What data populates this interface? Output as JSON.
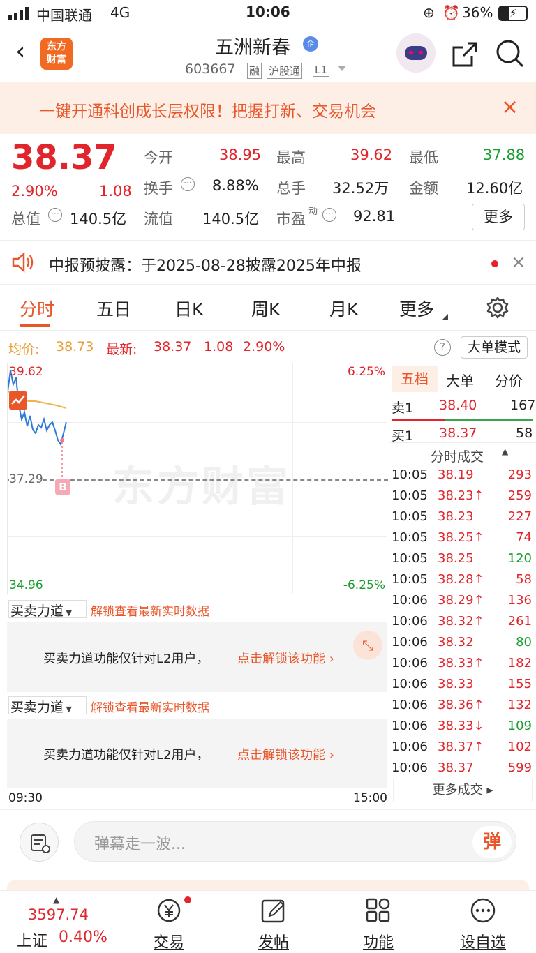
{
  "status": {
    "carrier": "中国联通",
    "network": "4G",
    "time": "10:06",
    "battery": "36%"
  },
  "nav": {
    "logo_line1": "东方",
    "logo_line2": "财富",
    "title": "五洲新春",
    "badge": "企",
    "code": "603667",
    "tag1": "融",
    "tag2": "沪股通",
    "tag3": "L1"
  },
  "banner": {
    "text": "一键开通科创成长层权限！把握打新、交易机会"
  },
  "quote": {
    "price": "38.37",
    "pct": "2.90%",
    "change": "1.08",
    "open_label": "今开",
    "open": "38.95",
    "high_label": "最高",
    "high": "39.62",
    "low_label": "最低",
    "low": "37.88",
    "turnover_label": "换手",
    "turnover": "8.88%",
    "volume_label": "总手",
    "volume": "32.52万",
    "amount_label": "金额",
    "amount": "12.60亿",
    "mcap_label": "总值",
    "mcap": "140.5亿",
    "float_label": "流值",
    "float": "140.5亿",
    "pe_label": "市盈",
    "pe_sup": "动",
    "pe": "92.81",
    "more": "更多"
  },
  "notice": {
    "text": "中报预披露：于2025-08-28披露2025年中报"
  },
  "tabs": [
    "分时",
    "五日",
    "日K",
    "周K",
    "月K",
    "更多"
  ],
  "legend": {
    "avg_label": "均价:",
    "avg": "38.73",
    "last_label": "最新:",
    "last": "38.37",
    "chg": "1.08",
    "pct": "2.90%",
    "mode": "大单模式"
  },
  "chart": {
    "top_left": "39.62",
    "top_right": "6.25%",
    "mid_left": "37.29",
    "bot_left": "34.96",
    "bot_right": "-6.25%",
    "watermark": "东方财富",
    "marker": "B",
    "time_start": "09:30",
    "time_end": "15:00"
  },
  "panels": [
    {
      "label": "买卖力道",
      "unlock": "解锁查看最新实时数据",
      "msg": "买卖力道功能仅针对L2用户，",
      "link": "点击解锁该功能"
    },
    {
      "label": "买卖力道",
      "unlock": "解锁查看最新实时数据",
      "msg": "买卖力道功能仅针对L2用户，",
      "link": "点击解锁该功能"
    }
  ],
  "side": {
    "tabs": [
      "五档",
      "大单",
      "分价"
    ],
    "sell1": {
      "label": "卖1",
      "price": "38.40",
      "vol": "167"
    },
    "buy1": {
      "label": "买1",
      "price": "38.37",
      "vol": "58"
    },
    "trades_title": "分时成交",
    "trades": [
      {
        "t": "10:05",
        "p": "38.19",
        "v": "293",
        "arrow": "",
        "vc": "red"
      },
      {
        "t": "10:05",
        "p": "38.23↑",
        "v": "259",
        "arrow": "",
        "vc": "red"
      },
      {
        "t": "10:05",
        "p": "38.23",
        "v": "227",
        "arrow": "",
        "vc": "red"
      },
      {
        "t": "10:05",
        "p": "38.25↑",
        "v": "74",
        "arrow": "",
        "vc": "red"
      },
      {
        "t": "10:05",
        "p": "38.25",
        "v": "120",
        "arrow": "",
        "vc": "green"
      },
      {
        "t": "10:05",
        "p": "38.28↑",
        "v": "58",
        "arrow": "",
        "vc": "red"
      },
      {
        "t": "10:06",
        "p": "38.29↑",
        "v": "136",
        "arrow": "",
        "vc": "red"
      },
      {
        "t": "10:06",
        "p": "38.32↑",
        "v": "261",
        "arrow": "",
        "vc": "red"
      },
      {
        "t": "10:06",
        "p": "38.32",
        "v": "80",
        "arrow": "",
        "vc": "green"
      },
      {
        "t": "10:06",
        "p": "38.33↑",
        "v": "182",
        "arrow": "",
        "vc": "red"
      },
      {
        "t": "10:06",
        "p": "38.33",
        "v": "155",
        "arrow": "",
        "vc": "red"
      },
      {
        "t": "10:06",
        "p": "38.36↑",
        "v": "132",
        "arrow": "",
        "vc": "red"
      },
      {
        "t": "10:06",
        "p": "38.33↓",
        "v": "109",
        "arrow": "",
        "vc": "green"
      },
      {
        "t": "10:06",
        "p": "38.37↑",
        "v": "102",
        "arrow": "",
        "vc": "red"
      },
      {
        "t": "10:06",
        "p": "38.37",
        "v": "599",
        "arrow": "",
        "vc": "red"
      }
    ],
    "more_trades": "更多成交"
  },
  "input": {
    "placeholder": "弹幕走一波...",
    "danmu": "弹"
  },
  "bottom": {
    "index_value": "3597.74",
    "index_name": "上证",
    "index_pct": "0.40%",
    "tabs": [
      "交易",
      "发帖",
      "功能",
      "设自选"
    ]
  }
}
